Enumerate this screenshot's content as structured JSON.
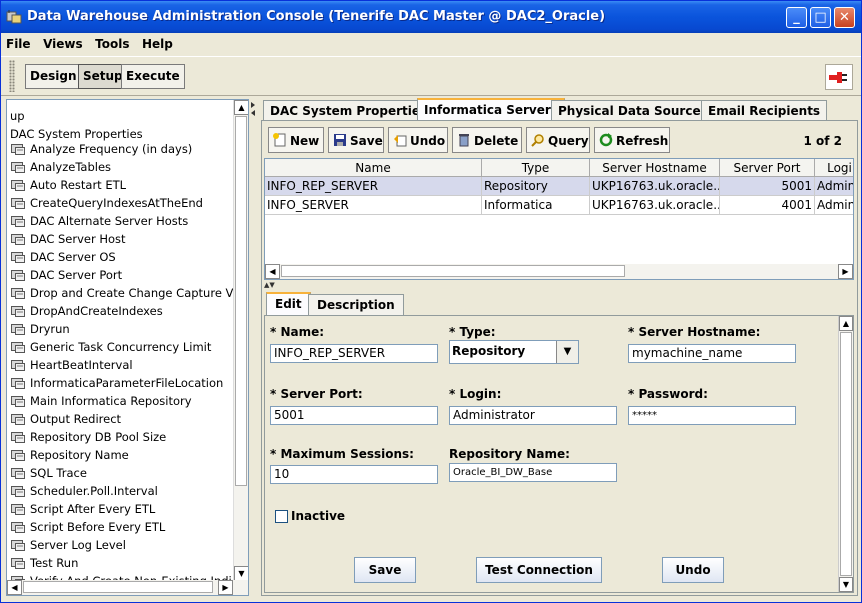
{
  "window": {
    "title": "Data Warehouse Administration Console (Tenerife DAC Master @ DAC2_Oracle)"
  },
  "menu": [
    "File",
    "Views",
    "Tools",
    "Help"
  ],
  "modes": {
    "design": "Design",
    "setup": "Setup",
    "execute": "Execute"
  },
  "tree": {
    "lines": [
      "up",
      "DAC System Properties"
    ],
    "items": [
      "Analyze Frequency (in days)",
      "AnalyzeTables",
      "Auto Restart ETL",
      "CreateQueryIndexesAtTheEnd",
      "DAC Alternate Server Hosts",
      "DAC Server Host",
      "DAC Server OS",
      "DAC Server Port",
      "Drop and Create Change Capture Vie",
      "DropAndCreateIndexes",
      "Dryrun",
      "Generic Task Concurrency Limit",
      "HeartBeatInterval",
      "InformaticaParameterFileLocation",
      "Main Informatica Repository",
      "Output Redirect",
      "Repository DB Pool Size",
      "Repository Name",
      "SQL Trace",
      "Scheduler.Poll.Interval",
      "Script After Every ETL",
      "Script Before Every ETL",
      "Server Log Level",
      "Test Run",
      "Verify And Create Non-Existing Indic"
    ]
  },
  "tabs": [
    "DAC System Properties",
    "Informatica Servers",
    "Physical Data Sources",
    "Email Recipients"
  ],
  "actions": {
    "new": "New",
    "save": "Save",
    "undo": "Undo",
    "delete": "Delete",
    "query": "Query",
    "refresh": "Refresh",
    "pager": "1 of 2"
  },
  "grid": {
    "columns": [
      "Name",
      "Type",
      "Server Hostname",
      "Server Port",
      "Logi"
    ],
    "rows": [
      {
        "name": "INFO_REP_SERVER",
        "type": "Repository",
        "host": "UKP16763.uk.oracle....",
        "port": "5001",
        "login": "Admin"
      },
      {
        "name": "INFO_SERVER",
        "type": "Informatica",
        "host": "UKP16763.uk.oracle....",
        "port": "4001",
        "login": "Admin"
      }
    ]
  },
  "subtabs": [
    "Edit",
    "Description"
  ],
  "form": {
    "name_label": "* Name:",
    "name_value": "INFO_REP_SERVER",
    "type_label": "* Type:",
    "type_value": "Repository",
    "host_label": "* Server Hostname:",
    "host_value": "mymachine_name",
    "port_label": "* Server Port:",
    "port_value": "5001",
    "login_label": "* Login:",
    "login_value": "Administrator",
    "password_label": "* Password:",
    "password_value": "*****",
    "maxsess_label": "* Maximum Sessions:",
    "maxsess_value": "10",
    "repo_label": "Repository Name:",
    "repo_value": "Oracle_BI_DW_Base",
    "inactive_label": "Inactive",
    "save_label": "Save",
    "test_label": "Test Connection",
    "undo_label": "Undo"
  }
}
